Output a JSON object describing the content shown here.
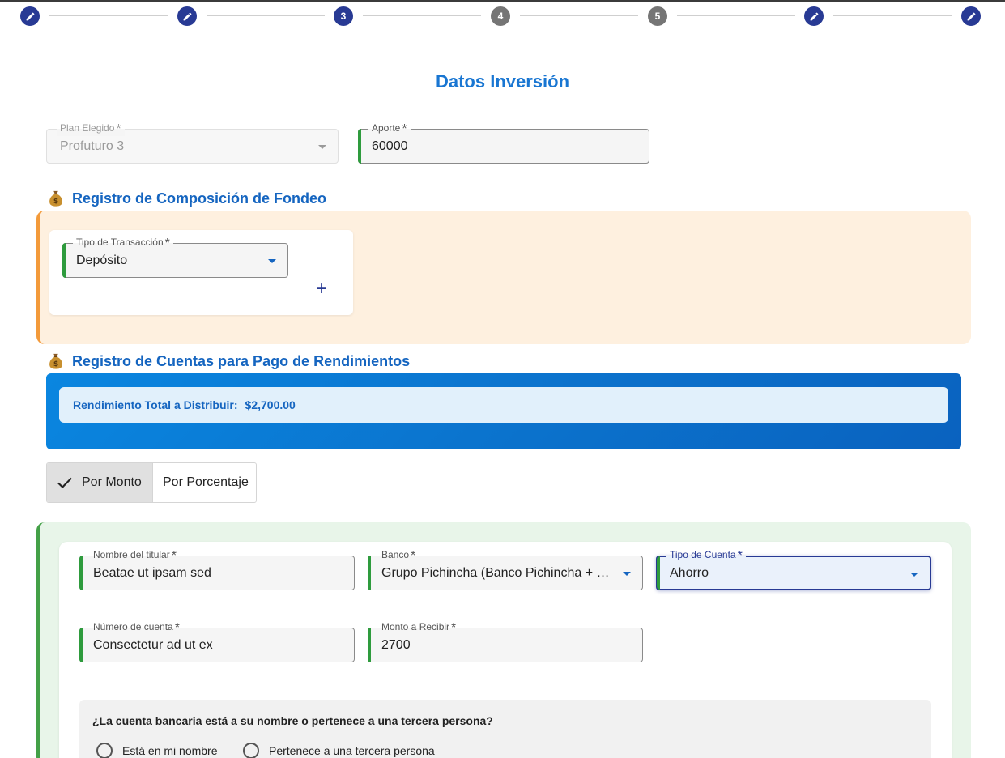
{
  "stepper": {
    "steps": [
      {
        "state": "done",
        "icon": "pencil-icon",
        "label": ""
      },
      {
        "state": "done",
        "icon": "pencil-icon",
        "label": ""
      },
      {
        "state": "active",
        "icon": "",
        "label": "3"
      },
      {
        "state": "pending",
        "icon": "",
        "label": "4"
      },
      {
        "state": "pending",
        "icon": "",
        "label": "5"
      },
      {
        "state": "done",
        "icon": "pencil-icon",
        "label": ""
      },
      {
        "state": "done",
        "icon": "pencil-icon",
        "label": ""
      }
    ]
  },
  "page_title": "Datos Inversión",
  "plan": {
    "label": "Plan Elegido",
    "required": "*",
    "value": "Profuturo 3"
  },
  "aporte": {
    "label": "Aporte",
    "required": "*",
    "value": "60000"
  },
  "fondeo": {
    "title": "Registro de Composición de Fondeo",
    "icon": "money-bag-icon",
    "tipo_transaccion": {
      "label": "Tipo de Transacción",
      "required": "*",
      "value": "Depósito"
    },
    "add_label": "+"
  },
  "rendimientos": {
    "title": "Registro de Cuentas para Pago de Rendimientos",
    "icon": "money-bag-icon",
    "total_label": "Rendimiento Total a Distribuir:",
    "total_value": "$2,700.00"
  },
  "distribution_toggle": {
    "options": [
      "Por Monto",
      "Por Porcentaje"
    ],
    "selected": "Por Monto"
  },
  "cuenta": {
    "nombre_titular": {
      "label": "Nombre del titular",
      "required": "*",
      "value": "Beatae ut ipsam sed"
    },
    "banco": {
      "label": "Banco",
      "required": "*",
      "value": "Grupo Pichincha (Banco Pichincha + …"
    },
    "tipo_cuenta": {
      "label": "Tipo de Cuenta",
      "required": "*",
      "value": "Ahorro"
    },
    "numero_cuenta": {
      "label": "Número de cuenta",
      "required": "*",
      "value": "Consectetur ad ut ex"
    },
    "monto": {
      "label": "Monto a Recibir",
      "required": "*",
      "value": "2700"
    },
    "question": "¿La cuenta bancaria está a su nombre o pertenece a una tercera persona?",
    "options": [
      "Está en mi nombre",
      "Pertenece a una tercera persona"
    ]
  },
  "colors": {
    "primary": "#283a94",
    "title_blue": "#1976d2",
    "success_green": "#2e9b3d",
    "orange_accent": "#f39a3a"
  }
}
